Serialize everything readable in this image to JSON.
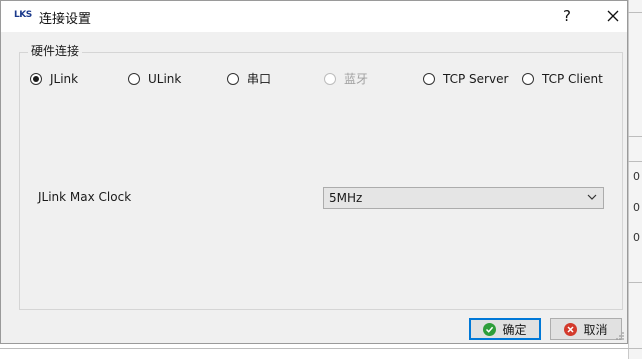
{
  "window": {
    "logo": "LKS",
    "title": "连接设置",
    "help_label": "?",
    "close_label": "✕"
  },
  "group": {
    "title": "硬件连接"
  },
  "connection_types": [
    {
      "label": "JLink",
      "checked": true,
      "enabled": true
    },
    {
      "label": "ULink",
      "checked": false,
      "enabled": true
    },
    {
      "label": "串口",
      "checked": false,
      "enabled": true
    },
    {
      "label": "蓝牙",
      "checked": false,
      "enabled": false
    },
    {
      "label": "TCP Server",
      "checked": false,
      "enabled": true
    },
    {
      "label": "TCP Client",
      "checked": false,
      "enabled": true
    }
  ],
  "clock": {
    "label": "JLink Max Clock",
    "selected": "5MHz"
  },
  "buttons": {
    "ok": "确定",
    "cancel": "取消"
  },
  "background": {
    "numbers": [
      "0",
      "0",
      "0"
    ]
  },
  "icons": {
    "ok": "check-circle-icon",
    "cancel": "cancel-circle-icon",
    "dropdown": "chevron-down-icon"
  }
}
